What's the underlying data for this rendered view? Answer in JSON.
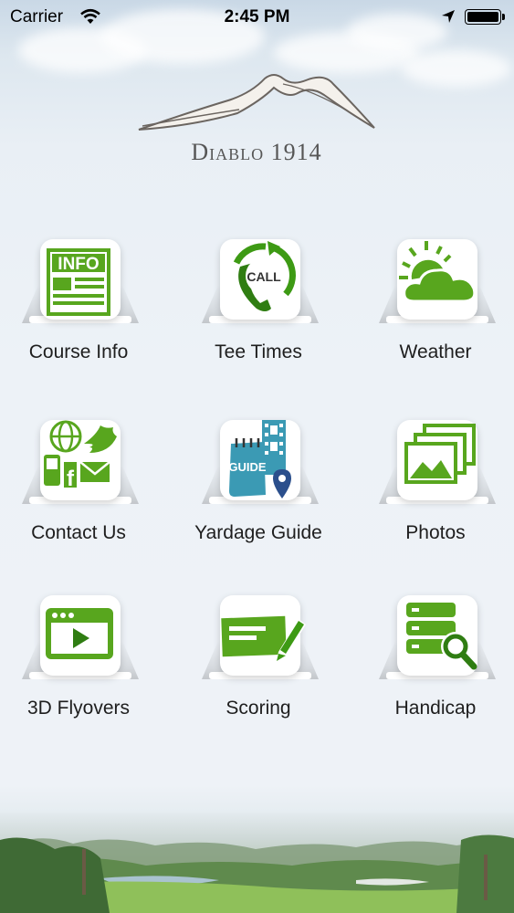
{
  "status_bar": {
    "carrier": "Carrier",
    "time": "2:45 PM"
  },
  "logo": {
    "text": "Diablo 1914"
  },
  "menu": {
    "items": [
      {
        "label": "Course Info",
        "icon": "info-newspaper-icon"
      },
      {
        "label": "Tee Times",
        "icon": "call-phone-icon"
      },
      {
        "label": "Weather",
        "icon": "sun-cloud-icon"
      },
      {
        "label": "Contact Us",
        "icon": "contact-social-icon"
      },
      {
        "label": "Yardage Guide",
        "icon": "guide-map-icon"
      },
      {
        "label": "Photos",
        "icon": "photos-icon"
      },
      {
        "label": "3D Flyovers",
        "icon": "video-player-icon"
      },
      {
        "label": "Scoring",
        "icon": "scorecard-pencil-icon"
      },
      {
        "label": "Handicap",
        "icon": "handicap-search-icon"
      }
    ]
  },
  "colors": {
    "accent_green": "#58a61e",
    "dark_green": "#2f7d12",
    "text": "#1e1e1e"
  }
}
